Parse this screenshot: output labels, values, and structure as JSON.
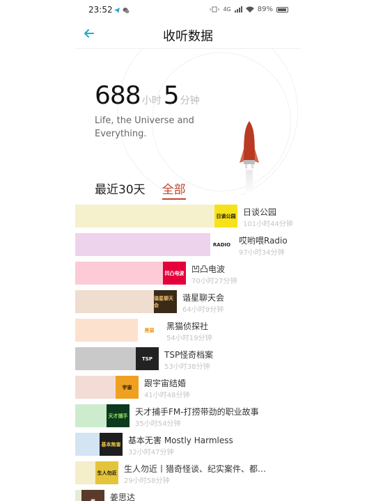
{
  "status_bar": {
    "time": "23:52",
    "network": "4G",
    "battery": "89%"
  },
  "header": {
    "title": "收听数据"
  },
  "summary": {
    "hours": "688",
    "hours_unit": "小时",
    "minutes": "5",
    "minutes_unit": "分钟",
    "subtitle": "Life, the Universe and Everything."
  },
  "tabs": [
    {
      "label": "最近30天",
      "active": false
    },
    {
      "label": "全部",
      "active": true
    }
  ],
  "podcasts": [
    {
      "name": "日谈公园",
      "duration": "101小时44分钟",
      "fraction": 0.72,
      "bar_color": "#f5f1cc",
      "cover_bg": "#f6e21b",
      "cover_fg": "#111111",
      "cover_text": "日谈公园"
    },
    {
      "name": "哎哟喂Radio",
      "duration": "97小时34分钟",
      "fraction": 0.7,
      "bar_color": "#eed3ec",
      "cover_bg": "#ffffff",
      "cover_fg": "#222222",
      "cover_text": "RADIO"
    },
    {
      "name": "凹凸电波",
      "duration": "70小时27分钟",
      "fraction": 0.49,
      "bar_color": "#fccbd6",
      "cover_bg": "#e5003c",
      "cover_fg": "#ffffff",
      "cover_text": "凹凸电波"
    },
    {
      "name": "谐星聊天会",
      "duration": "64小时9分钟",
      "fraction": 0.45,
      "bar_color": "#efddcf",
      "cover_bg": "#3a2a18",
      "cover_fg": "#f0c070",
      "cover_text": "谐星聊天会"
    },
    {
      "name": "黑猫侦探社",
      "duration": "54小时19分钟",
      "fraction": 0.38,
      "bar_color": "#fde1cf",
      "cover_bg": "#ffffff",
      "cover_fg": "#e89a1c",
      "cover_text": "黑猫"
    },
    {
      "name": "TSP怪奇档案",
      "duration": "53小时38分钟",
      "fraction": 0.37,
      "bar_color": "#c9c9c9",
      "cover_bg": "#222222",
      "cover_fg": "#ffffff",
      "cover_text": "TSP"
    },
    {
      "name": "跟宇宙结婚",
      "duration": "41小时48分钟",
      "fraction": 0.28,
      "bar_color": "#f3dcd6",
      "cover_bg": "#f0a020",
      "cover_fg": "#111111",
      "cover_text": "宇宙"
    },
    {
      "name": "天才捕手FM-打捞带劲的职业故事",
      "duration": "35小时54分钟",
      "fraction": 0.24,
      "bar_color": "#cdeccd",
      "cover_bg": "#0c3a1e",
      "cover_fg": "#9ee06a",
      "cover_text": "天才捕手"
    },
    {
      "name": "基本无害 Mostly Harmless",
      "duration": "32小时47分钟",
      "fraction": 0.21,
      "bar_color": "#d3e5f3",
      "cover_bg": "#1e1e1e",
      "cover_fg": "#e8c44a",
      "cover_text": "基本無害"
    },
    {
      "name": "生人勿近丨猎奇怪谈、纪实案件、都…",
      "duration": "29小时58分钟",
      "fraction": 0.19,
      "bar_color": "#f4eeca",
      "cover_bg": "#e4c43a",
      "cover_fg": "#111111",
      "cover_text": "生人勿近"
    },
    {
      "name": "姜思达",
      "duration": "",
      "fraction": 0.13,
      "bar_color": "#e6ecd6",
      "cover_bg": "#5a3a2a",
      "cover_fg": "#ffffff",
      "cover_text": "姜"
    }
  ],
  "colors": {
    "accent": "#c0452a",
    "back_arrow": "#1fa8c9",
    "muted": "#c4c4c4"
  }
}
